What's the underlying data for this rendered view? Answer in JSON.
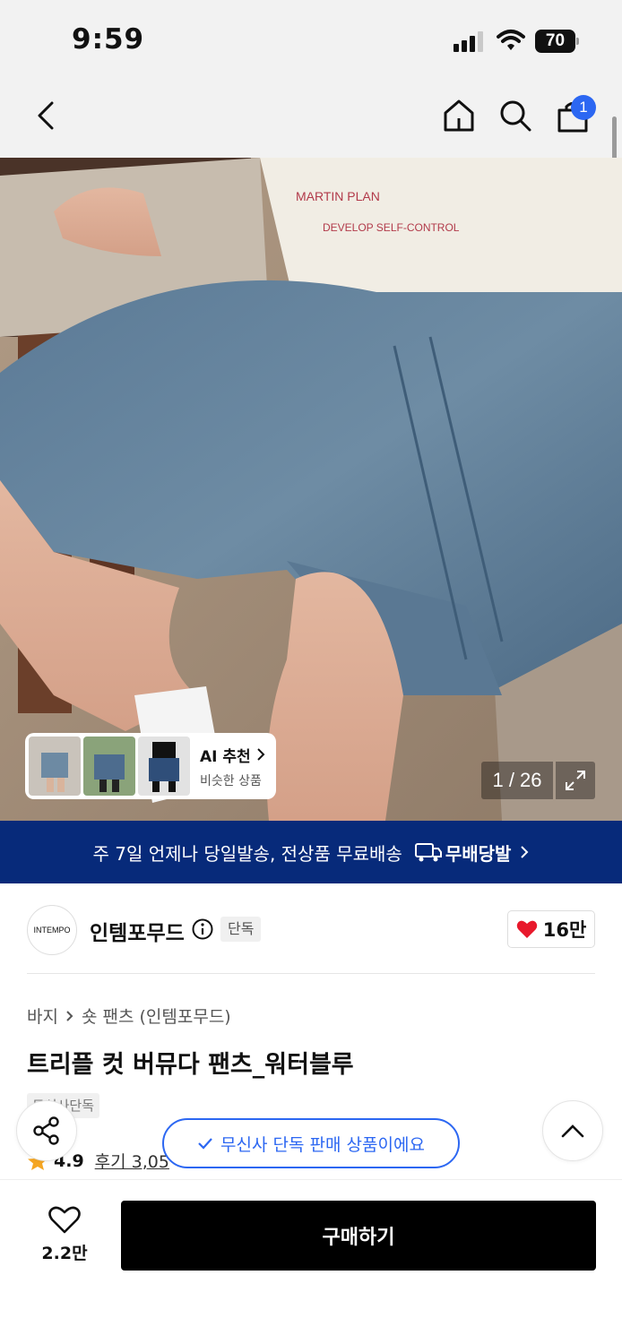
{
  "status_bar": {
    "time": "9:59",
    "battery": "70"
  },
  "nav": {
    "cart_count": "1"
  },
  "gallery": {
    "ai_title": "AI 추천",
    "ai_subtitle": "비슷한 상품",
    "counter": "1 / 26"
  },
  "shipping_banner": {
    "text": "주 7일 언제나 당일발송, 전상품 무료배송",
    "logo_text": "무배당발"
  },
  "brand": {
    "logo_text": "INTEMPO",
    "name": "인템포무드",
    "tag": "단독",
    "likes": "16만"
  },
  "product": {
    "category": "바지",
    "subcategory": "숏 팬츠 (인템포무드)",
    "title": "트리플 컷 버뮤다 팬츠_워터블루",
    "exclusive_tag": "무신사단독",
    "rating": "4.9",
    "reviews": "후기 3,05"
  },
  "toast": {
    "text": "무신사 단독 판매 상품이에요"
  },
  "bottom_bar": {
    "wish_count": "2.2만",
    "buy_label": "구매하기"
  },
  "colors": {
    "accent": "#2c67f2",
    "banner": "#072a7a",
    "heart": "#e8192c"
  }
}
